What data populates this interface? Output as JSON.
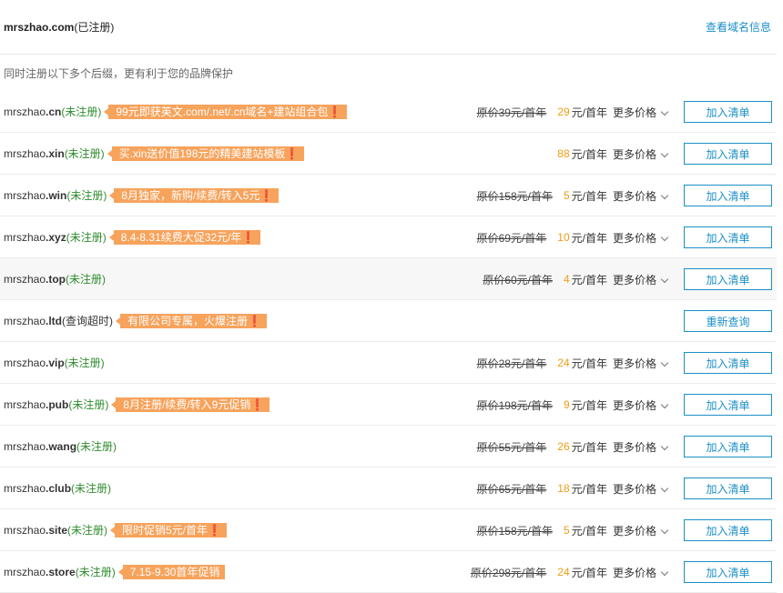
{
  "header": {
    "domain": "mrszhao.com",
    "status": "(已注册)",
    "info_link": "查看域名信息"
  },
  "hint": "同时注册以下多个后缀，更有利于您的品牌保护",
  "rows": [
    {
      "base": "mrszhao",
      "suffix": ".cn",
      "status": "(未注册)",
      "promo": "99元即获英文.com/.net/.cn域名+建站组合包❗",
      "orig": "原价39元/首年",
      "price": "29",
      "unit": "元/首年",
      "more": "更多价格",
      "button": "加入清单"
    },
    {
      "base": "mrszhao",
      "suffix": ".xin",
      "status": "(未注册)",
      "promo": "买.xin送价值198元的精美建站模板❗",
      "orig": "",
      "price": "88",
      "unit": "元/首年",
      "more": "更多价格",
      "button": "加入清单"
    },
    {
      "base": "mrszhao",
      "suffix": ".win",
      "status": "(未注册)",
      "promo": "8月独家，新购/续费/转入5元❗",
      "orig": "原价158元/首年",
      "price": "5",
      "unit": "元/首年",
      "more": "更多价格",
      "button": "加入清单"
    },
    {
      "base": "mrszhao",
      "suffix": ".xyz",
      "status": "(未注册)",
      "promo": "8.4-8.31续费大促32元/年❗",
      "orig": "原价69元/首年",
      "price": "10",
      "unit": "元/首年",
      "more": "更多价格",
      "button": "加入清单"
    },
    {
      "base": "mrszhao",
      "suffix": ".top",
      "status": "(未注册)",
      "promo": "",
      "orig": "原价60元/首年",
      "price": "4",
      "unit": "元/首年",
      "more": "更多价格",
      "button": "加入清单"
    },
    {
      "base": "mrszhao",
      "suffix": ".ltd",
      "status": "(查询超时)",
      "promo": "有限公司专属，火爆注册❗",
      "orig": "",
      "price": "",
      "unit": "",
      "more": "",
      "button": "重新查询"
    },
    {
      "base": "mrszhao",
      "suffix": ".vip",
      "status": "(未注册)",
      "promo": "",
      "orig": "原价28元/首年",
      "price": "24",
      "unit": "元/首年",
      "more": "更多价格",
      "button": "加入清单"
    },
    {
      "base": "mrszhao",
      "suffix": ".pub",
      "status": "(未注册)",
      "promo": "8月注册/续费/转入9元促销❗",
      "orig": "原价198元/首年",
      "price": "9",
      "unit": "元/首年",
      "more": "更多价格",
      "button": "加入清单"
    },
    {
      "base": "mrszhao",
      "suffix": ".wang",
      "status": "(未注册)",
      "promo": "",
      "orig": "原价55元/首年",
      "price": "26",
      "unit": "元/首年",
      "more": "更多价格",
      "button": "加入清单"
    },
    {
      "base": "mrszhao",
      "suffix": ".club",
      "status": "(未注册)",
      "promo": "",
      "orig": "原价65元/首年",
      "price": "18",
      "unit": "元/首年",
      "more": "更多价格",
      "button": "加入清单"
    },
    {
      "base": "mrszhao",
      "suffix": ".site",
      "status": "(未注册)",
      "promo": "限时促销5元/首年❗",
      "orig": "原价158元/首年",
      "price": "5",
      "unit": "元/首年",
      "more": "更多价格",
      "button": "加入清单"
    },
    {
      "base": "mrszhao",
      "suffix": ".store",
      "status": "(未注册)",
      "promo": "7.15-9.30首年促销",
      "orig": "原价298元/首年",
      "price": "24",
      "unit": "元/首年",
      "more": "更多价格",
      "button": "加入清单"
    }
  ],
  "colors": {
    "accent": "#1c8fc7",
    "promo": "#f7a35c",
    "price": "#f39c12",
    "available": "#2e8b2e"
  }
}
